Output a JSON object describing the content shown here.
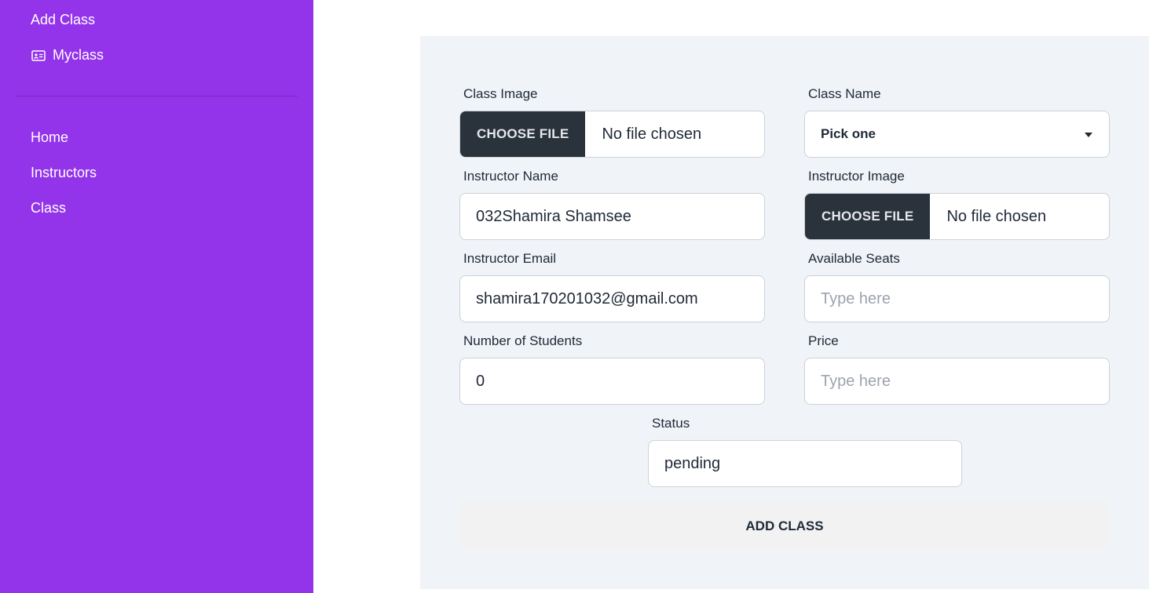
{
  "sidebar": {
    "top_items": [
      {
        "label": "Add Class",
        "icon": ""
      },
      {
        "label": "Myclass",
        "icon": "class-icon"
      }
    ],
    "bottom_items": [
      {
        "label": "Home"
      },
      {
        "label": "Instructors"
      },
      {
        "label": "Class"
      }
    ],
    "background_color": "#9333ea"
  },
  "form": {
    "class_image": {
      "label": "Class Image",
      "button": "CHOOSE FILE",
      "status": "No file chosen"
    },
    "class_name": {
      "label": "Class Name",
      "selected": "Pick one"
    },
    "instructor_name": {
      "label": "Instructor Name",
      "value": "032Shamira Shamsee"
    },
    "instructor_image": {
      "label": "Instructor Image",
      "button": "CHOOSE FILE",
      "status": "No file chosen"
    },
    "instructor_email": {
      "label": "Instructor Email",
      "value": "shamira170201032@gmail.com"
    },
    "available_seats": {
      "label": "Available Seats",
      "placeholder": "Type here"
    },
    "number_of_students": {
      "label": "Number of Students",
      "value": "0"
    },
    "price": {
      "label": "Price",
      "placeholder": "Type here"
    },
    "status": {
      "label": "Status",
      "value": "pending"
    },
    "submit_label": "ADD CLASS"
  }
}
